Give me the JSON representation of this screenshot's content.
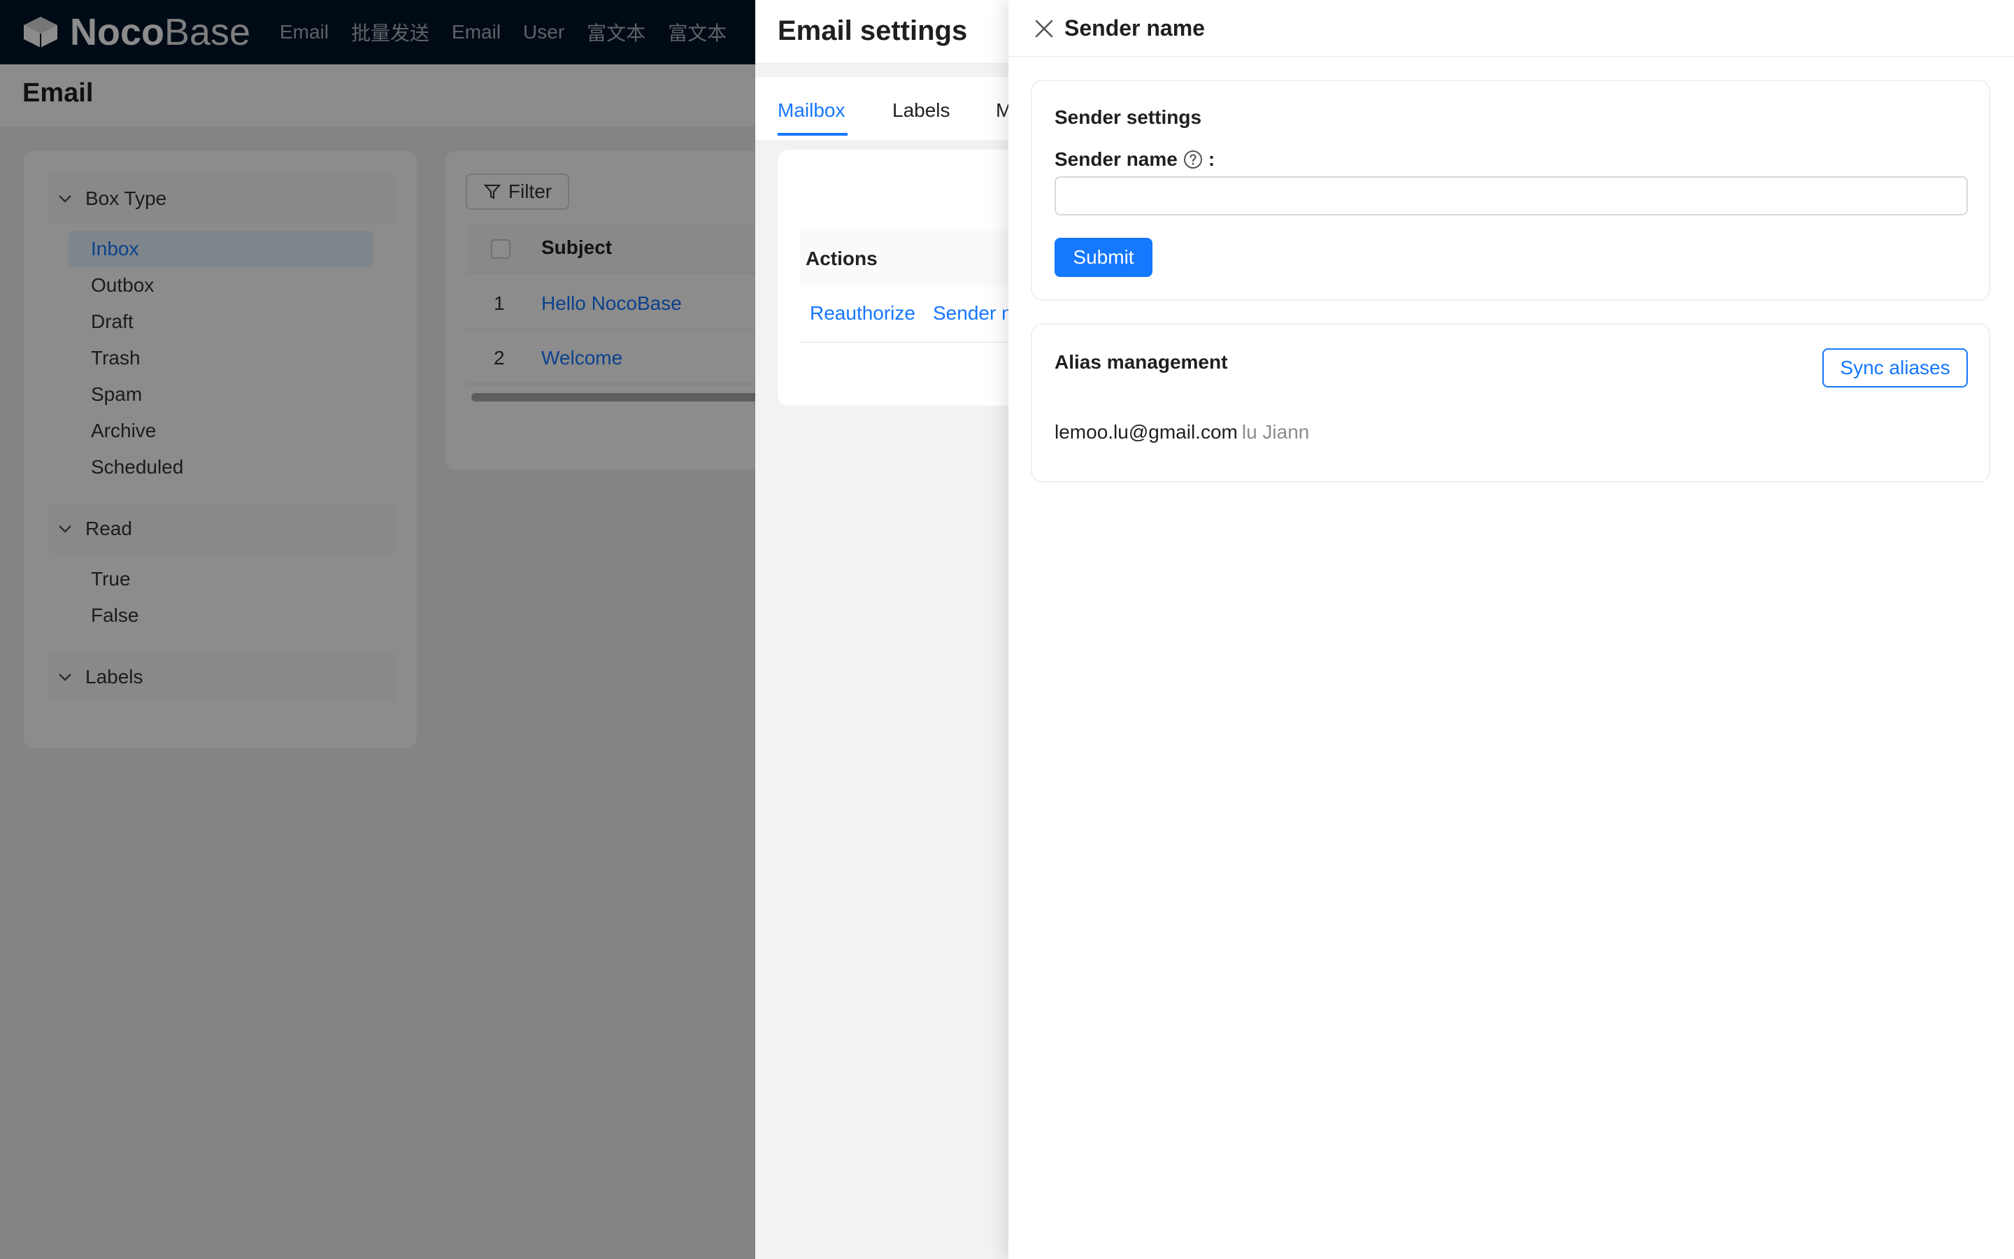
{
  "app": {
    "brand_bold": "Noco",
    "brand_light": "Base",
    "nav_items": [
      "Email",
      "批量发送",
      "Email",
      "User",
      "富文本",
      "富文本"
    ]
  },
  "page": {
    "title": "Email"
  },
  "filters": {
    "box_type": {
      "label": "Box Type",
      "items": [
        "Inbox",
        "Outbox",
        "Draft",
        "Trash",
        "Spam",
        "Archive",
        "Scheduled"
      ],
      "active": "Inbox"
    },
    "read": {
      "label": "Read",
      "items": [
        "True",
        "False"
      ]
    },
    "labels": {
      "label": "Labels"
    }
  },
  "table": {
    "filter_label": "Filter",
    "subject_header": "Subject",
    "rows": [
      {
        "num": "1",
        "subject": "Hello NocoBase"
      },
      {
        "num": "2",
        "subject": "Welcome"
      }
    ]
  },
  "email_settings": {
    "title": "Email settings",
    "tabs": [
      "Mailbox",
      "Labels",
      "M"
    ],
    "active_tab": "Mailbox",
    "actions_header": "Actions",
    "actions": [
      "Reauthorize",
      "Sender n"
    ]
  },
  "sender_drawer": {
    "title": "Sender name",
    "sender_settings": {
      "title": "Sender settings",
      "field_label": "Sender name",
      "field_colon": ":",
      "field_value": "",
      "submit_label": "Submit"
    },
    "alias_management": {
      "title": "Alias management",
      "sync_label": "Sync aliases",
      "aliases": [
        {
          "email": "lemoo.lu@gmail.com",
          "name": "lu Jiann"
        }
      ]
    }
  },
  "colors": {
    "primary": "#1677ff",
    "nav_bg": "#001529"
  }
}
